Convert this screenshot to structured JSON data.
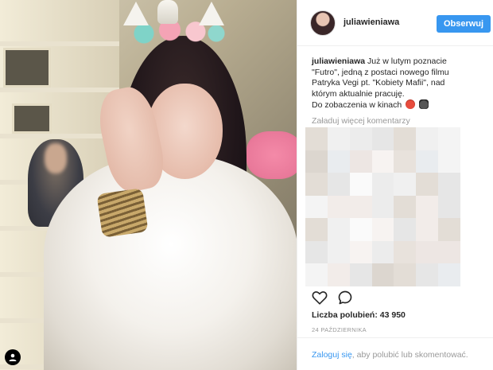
{
  "post": {
    "username": "juliawieniawa",
    "follow_label": "Obserwuj",
    "caption_user": "juliawieniawa",
    "caption_lines": [
      "Już w lutym poznacie",
      "\"Futro\", jedną z postaci nowego filmu",
      "Patryka Vegi pt. \"Kobiety Mafii\", nad",
      "którym aktualnie pracuję.",
      "Do zobaczenia w kinach"
    ],
    "caption_emojis": [
      "devil-emoji",
      "film-clapper-emoji"
    ],
    "load_more": "Załaduj więcej komentarzy",
    "likes_label": "Liczba polubień:",
    "likes_count": "43 950",
    "date": "24 PAŹDZIERNIKA",
    "footer_login": "Zaloguj się",
    "footer_rest": ", aby polubić lub skomentować."
  },
  "colors": {
    "follow_button": "#3897f0",
    "link": "#3897f0",
    "muted": "#999999",
    "text": "#262626",
    "divider": "#efefef"
  },
  "icons": {
    "like": "heart-icon",
    "comment": "comment-icon",
    "photo_tag": "user-tag-icon"
  }
}
